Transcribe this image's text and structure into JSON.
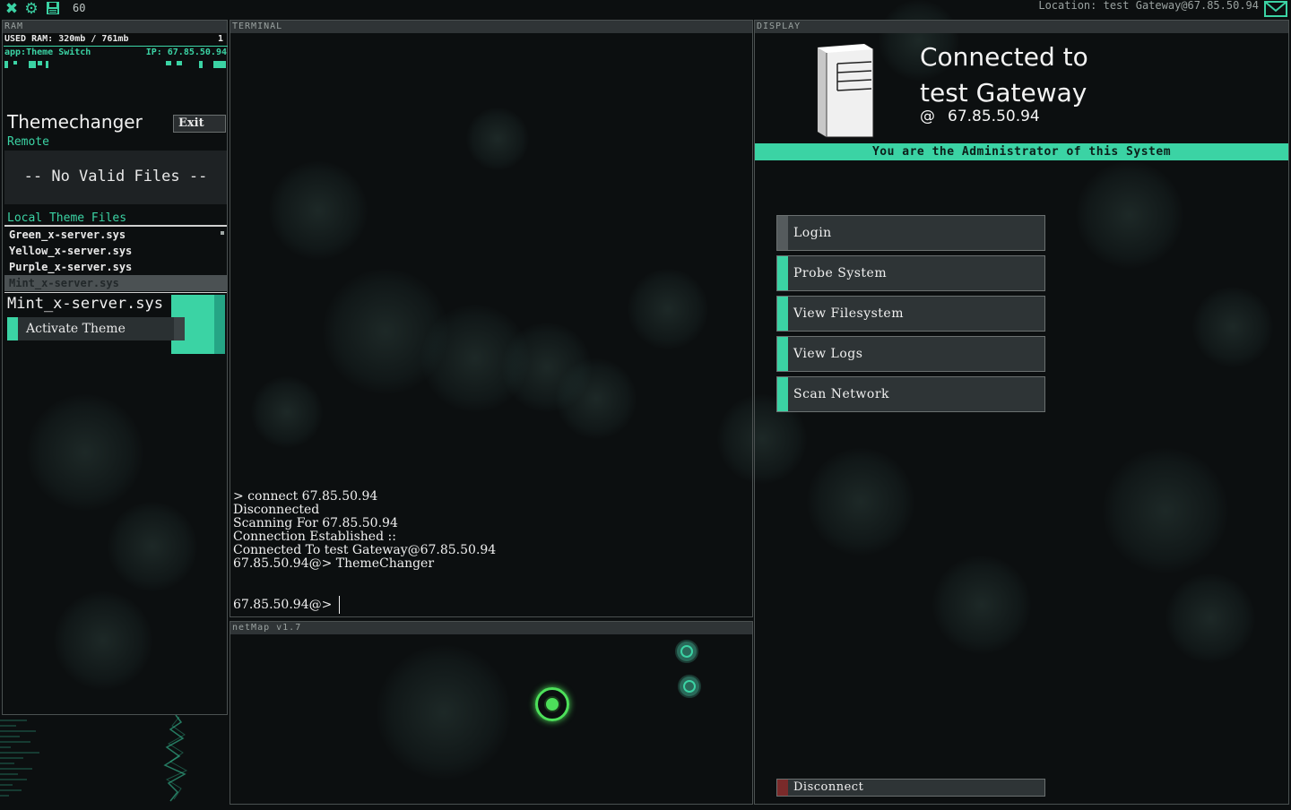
{
  "topbar": {
    "fps": "60",
    "location": "Location: test Gateway@67.85.50.94"
  },
  "ram": {
    "title": "RAM",
    "used_label": "USED RAM: 320mb / 761mb",
    "process_count": "1",
    "app_name": "app:Theme Switch",
    "app_ip": "IP: 67.85.50.94"
  },
  "themechanger": {
    "title": "Themechanger",
    "exit_label": "Exit",
    "remote_label": "Remote",
    "no_files": "-- No Valid Files --",
    "local_label": "Local Theme Files",
    "files": [
      "Green_x-server.sys",
      "Yellow_x-server.sys",
      "Purple_x-server.sys",
      "Mint_x-server.sys"
    ],
    "selected_file": "Mint_x-server.sys",
    "activate_label": "Activate Theme"
  },
  "terminal": {
    "title": "TERMINAL",
    "lines": [
      "> connect 67.85.50.94",
      "Disconnected",
      "Scanning For 67.85.50.94",
      "Connection Established ::",
      "Connected To test Gateway@67.85.50.94",
      "67.85.50.94@> ThemeChanger"
    ],
    "prompt": "67.85.50.94@>"
  },
  "netmap": {
    "title": "netMap v1.7"
  },
  "display": {
    "title": "DISPLAY",
    "connected_line1": "Connected to",
    "connected_line2": "test Gateway",
    "at_symbol": "@",
    "ip": "67.85.50.94",
    "admin_text": "You are the Administrator of this System",
    "buttons": [
      "Login",
      "Probe System",
      "View Filesystem",
      "View Logs",
      "Scan Network"
    ],
    "disconnect_label": "Disconnect"
  },
  "colors": {
    "accent": "#3bd3a4",
    "background": "#0c0f10",
    "disconnect_accent": "#7a2a2a"
  }
}
